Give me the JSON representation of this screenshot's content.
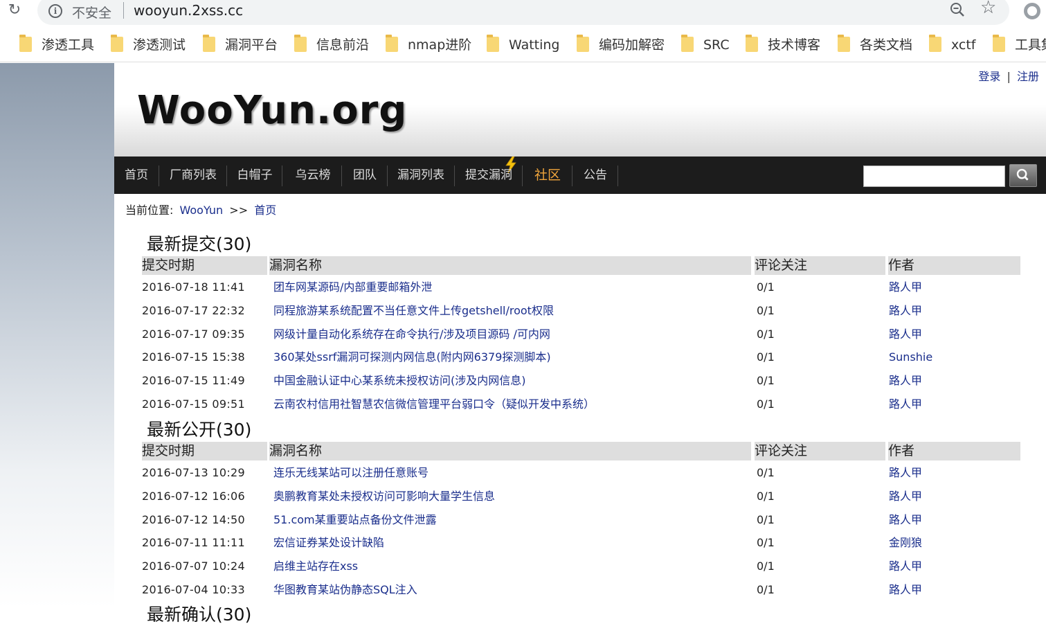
{
  "browser": {
    "security_label": "不安全",
    "url": "wooyun.2xss.cc"
  },
  "bookmarks": [
    "渗透工具",
    "渗透测试",
    "漏洞平台",
    "信息前沿",
    "nmap进阶",
    "Watting",
    "编码加解密",
    "SRC",
    "技术博客",
    "各类文档",
    "xctf",
    "工具集"
  ],
  "header": {
    "logo": "WooYun.org",
    "login": "登录",
    "divider": "|",
    "register": "注册"
  },
  "nav": {
    "items": [
      "首页",
      "厂商列表",
      "白帽子",
      "乌云榜",
      "团队",
      "漏洞列表",
      "提交漏洞",
      "社区",
      "公告"
    ]
  },
  "breadcrumb": {
    "prefix": "当前位置:",
    "home": "WooYun",
    "sep": ">>",
    "current": "首页"
  },
  "columns": {
    "time": "提交时期",
    "name": "漏洞名称",
    "comments": "评论关注",
    "author": "作者"
  },
  "sections": [
    {
      "title": "最新提交(30)",
      "rows": [
        {
          "time": "2016-07-18 11:41",
          "title": "团车网某源码/内部重要邮箱外泄",
          "comments": "0/1",
          "author": "路人甲"
        },
        {
          "time": "2016-07-17 22:32",
          "title": "同程旅游某系统配置不当任意文件上传getshell/root权限",
          "comments": "0/1",
          "author": "路人甲"
        },
        {
          "time": "2016-07-17 09:35",
          "title": "网级计量自动化系统存在命令执行/涉及项目源码 /可内网",
          "comments": "0/1",
          "author": "路人甲"
        },
        {
          "time": "2016-07-15 15:38",
          "title": "360某处ssrf漏洞可探测内网信息(附内网6379探测脚本)",
          "comments": "0/1",
          "author": "Sunshie"
        },
        {
          "time": "2016-07-15 11:49",
          "title": "中国金融认证中心某系统未授权访问(涉及内网信息)",
          "comments": "0/1",
          "author": "路人甲"
        },
        {
          "time": "2016-07-15 09:51",
          "title": "云南农村信用社智慧农信微信管理平台弱口令（疑似开发中系统）",
          "comments": "0/1",
          "author": "路人甲"
        }
      ]
    },
    {
      "title": "最新公开(30)",
      "rows": [
        {
          "time": "2016-07-13 10:29",
          "title": "连乐无线某站可以注册任意账号",
          "comments": "0/1",
          "author": "路人甲"
        },
        {
          "time": "2016-07-12 16:06",
          "title": "奥鹏教育某处未授权访问可影响大量学生信息",
          "comments": "0/1",
          "author": "路人甲"
        },
        {
          "time": "2016-07-12 14:50",
          "title": "51.com某重要站点备份文件泄露",
          "comments": "0/1",
          "author": "路人甲"
        },
        {
          "time": "2016-07-11 11:11",
          "title": "宏信证券某处设计缺陷",
          "comments": "0/1",
          "author": "金刚狼"
        },
        {
          "time": "2016-07-07 10:24",
          "title": "启维主站存在xss",
          "comments": "0/1",
          "author": "路人甲"
        },
        {
          "time": "2016-07-04 10:33",
          "title": "华图教育某站伪静态SQL注入",
          "comments": "0/1",
          "author": "路人甲"
        }
      ]
    },
    {
      "title": "最新确认(30)"
    }
  ]
}
